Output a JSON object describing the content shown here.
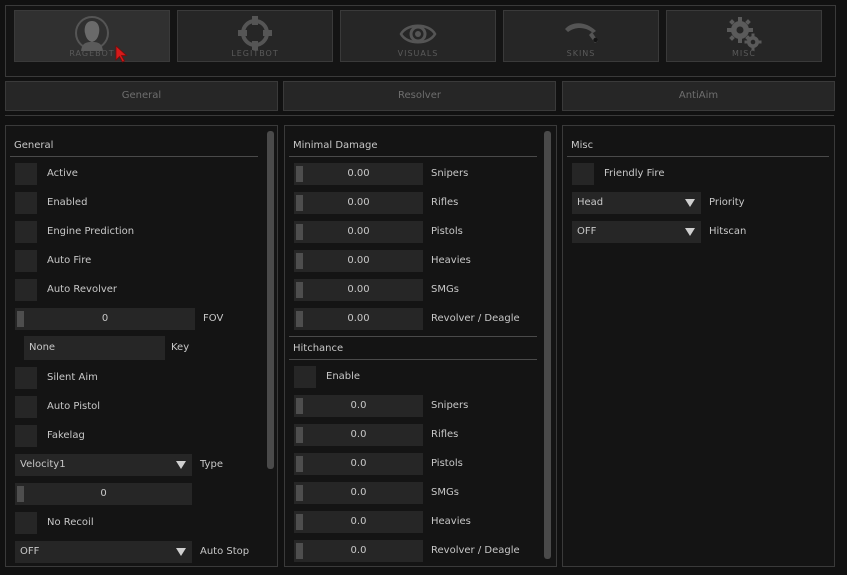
{
  "tabs": [
    {
      "label": "RAGEBOT",
      "icon": "ragebot-icon"
    },
    {
      "label": "LEGITBOT",
      "icon": "crosshair-icon"
    },
    {
      "label": "VISUALS",
      "icon": "eye-icon"
    },
    {
      "label": "SKINS",
      "icon": "knife-icon"
    },
    {
      "label": "MISC",
      "icon": "gears-icon"
    }
  ],
  "subtabs": [
    "General",
    "Resolver",
    "AntiAim"
  ],
  "general": {
    "title": "General",
    "active": "Active",
    "enabled": "Enabled",
    "engine_prediction": "Engine Prediction",
    "auto_fire": "Auto Fire",
    "auto_revolver": "Auto Revolver",
    "fov": {
      "value": "0",
      "label": "FOV"
    },
    "key": {
      "value": "None",
      "label": "Key"
    },
    "silent_aim": "Silent Aim",
    "auto_pistol": "Auto Pistol",
    "fakelag": "Fakelag",
    "type": {
      "value": "Velocity1",
      "label": "Type"
    },
    "fakelag_amount": "0",
    "no_recoil": "No Recoil",
    "auto_stop": {
      "value": "OFF",
      "label": "Auto Stop"
    }
  },
  "minimal_damage": {
    "title": "Minimal Damage",
    "rows": [
      {
        "value": "0.00",
        "label": "Snipers"
      },
      {
        "value": "0.00",
        "label": "Rifles"
      },
      {
        "value": "0.00",
        "label": "Pistols"
      },
      {
        "value": "0.00",
        "label": "Heavies"
      },
      {
        "value": "0.00",
        "label": "SMGs"
      },
      {
        "value": "0.00",
        "label": "Revolver / Deagle"
      }
    ]
  },
  "hitchance": {
    "title": "Hitchance",
    "enable": "Enable",
    "rows": [
      {
        "value": "0.0",
        "label": "Snipers"
      },
      {
        "value": "0.0",
        "label": "Rifles"
      },
      {
        "value": "0.0",
        "label": "Pistols"
      },
      {
        "value": "0.0",
        "label": "SMGs"
      },
      {
        "value": "0.0",
        "label": "Heavies"
      },
      {
        "value": "0.0",
        "label": "Revolver / Deagle"
      }
    ]
  },
  "misc": {
    "title": "Misc",
    "friendly_fire": "Friendly Fire",
    "priority": {
      "value": "Head",
      "label": "Priority"
    },
    "hitscan": {
      "value": "OFF",
      "label": "Hitscan"
    }
  },
  "colors": {
    "background": "#111111",
    "control": "#262626",
    "border": "#3a3a3a",
    "text": "#c8c8c8",
    "cursor": "#e02020"
  }
}
